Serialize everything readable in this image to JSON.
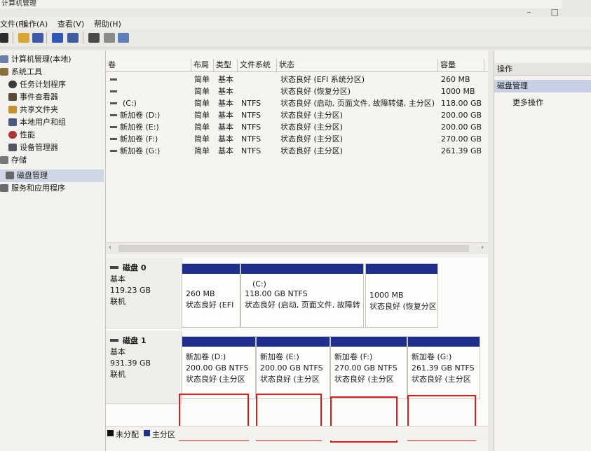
{
  "window": {
    "title": "计算机管理"
  },
  "menu": [
    "文件(F)",
    "操作(A)",
    "查看(V)",
    "帮助(H)"
  ],
  "tree": {
    "items": [
      {
        "label": "计算机管理(本地)",
        "icon": "computer-icon"
      },
      {
        "label": "系统工具",
        "icon": "tools-icon"
      },
      {
        "label": "任务计划程序",
        "icon": "clock-icon"
      },
      {
        "label": "事件查看器",
        "icon": "event-viewer-icon"
      },
      {
        "label": "共享文件夹",
        "icon": "shared-folder-icon"
      },
      {
        "label": "本地用户和组",
        "icon": "users-icon"
      },
      {
        "label": "性能",
        "icon": "performance-icon"
      },
      {
        "label": "设备管理器",
        "icon": "device-manager-icon"
      },
      {
        "label": "存储",
        "icon": "storage-icon"
      },
      {
        "label": "磁盘管理",
        "icon": "disk-management-icon"
      },
      {
        "label": "服务和应用程序",
        "icon": "services-icon"
      }
    ]
  },
  "volume_table": {
    "headers": [
      "卷",
      "布局",
      "类型",
      "文件系统",
      "状态",
      "容量"
    ],
    "rows": [
      {
        "volume": "",
        "layout": "简单",
        "type": "基本",
        "fs": "",
        "status": "状态良好 (EFI 系统分区)",
        "capacity": "260 MB"
      },
      {
        "volume": "",
        "layout": "简单",
        "type": "基本",
        "fs": "",
        "status": "状态良好 (恢复分区)",
        "capacity": "1000 MB"
      },
      {
        "volume": "(C:)",
        "layout": "简单",
        "type": "基本",
        "fs": "NTFS",
        "status": "状态良好 (启动, 页面文件, 故障转储, 主分区)",
        "capacity": "118.00 GB"
      },
      {
        "volume": "新加卷 (D:)",
        "layout": "简单",
        "type": "基本",
        "fs": "NTFS",
        "status": "状态良好 (主分区)",
        "capacity": "200.00 GB"
      },
      {
        "volume": "新加卷 (E:)",
        "layout": "简单",
        "type": "基本",
        "fs": "NTFS",
        "status": "状态良好 (主分区)",
        "capacity": "200.00 GB"
      },
      {
        "volume": "新加卷 (F:)",
        "layout": "简单",
        "type": "基本",
        "fs": "NTFS",
        "status": "状态良好 (主分区)",
        "capacity": "270.00 GB"
      },
      {
        "volume": "新加卷 (G:)",
        "layout": "简单",
        "type": "基本",
        "fs": "NTFS",
        "status": "状态良好 (主分区)",
        "capacity": "261.39 GB"
      }
    ]
  },
  "disks": [
    {
      "name": "磁盘 0",
      "kind": "基本",
      "size": "119.23 GB",
      "state": "联机",
      "partitions": [
        {
          "label": "",
          "size": "260 MB",
          "status": "状态良好 (EFI"
        },
        {
          "label": "(C:)",
          "size": "118.00 GB NTFS",
          "status": "状态良好 (启动, 页面文件, 故障转"
        },
        {
          "label": "",
          "size": "1000 MB",
          "status": "状态良好 (恢复分区"
        }
      ]
    },
    {
      "name": "磁盘 1",
      "kind": "基本",
      "size": "931.39 GB",
      "state": "联机",
      "partitions": [
        {
          "label": "新加卷 (D:)",
          "size": "200.00 GB NTFS",
          "status": "状态良好 (主分区"
        },
        {
          "label": "新加卷 (E:)",
          "size": "200.00 GB NTFS",
          "status": "状态良好 (主分区"
        },
        {
          "label": "新加卷 (F:)",
          "size": "270.00 GB NTFS",
          "status": "状态良好 (主分区"
        },
        {
          "label": "新加卷 (G:)",
          "size": "261.39 GB NTFS",
          "status": "状态良好 (主分区"
        }
      ]
    }
  ],
  "legend": {
    "unallocated": "未分配",
    "primary": "主分区"
  },
  "actions": {
    "header": "操作",
    "section": "磁盘管理",
    "more": "更多操作"
  },
  "colors": {
    "partition_bar": "#1f2f8e",
    "unallocated": "#111111",
    "highlight_box": "#e01919"
  }
}
